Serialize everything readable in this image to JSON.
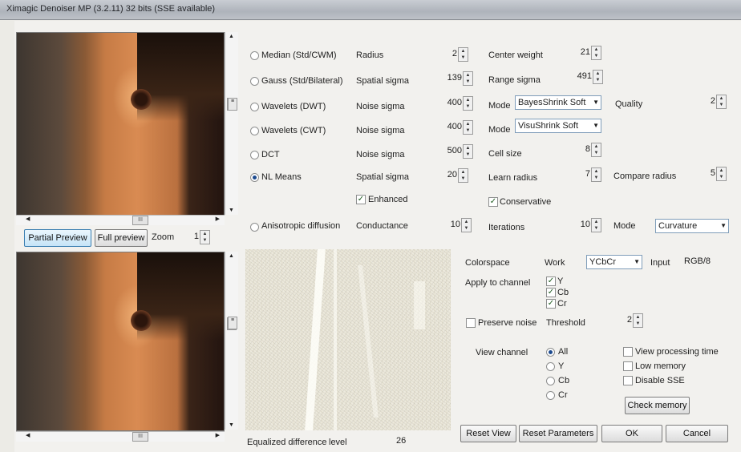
{
  "window": {
    "title": "Ximagic Denoiser MP (3.2.11) 32 bits (SSE available)"
  },
  "preview": {
    "partial_label": "Partial Preview",
    "full_label": "Full preview",
    "zoom_label": "Zoom",
    "zoom_value": "1"
  },
  "methods": [
    {
      "label": "Median (Std/CWM)",
      "selected": false,
      "p1_label": "Radius",
      "p1_value": "2",
      "p2_label": "Center weight",
      "p2_value": "21"
    },
    {
      "label": "Gauss (Std/Bilateral)",
      "selected": false,
      "p1_label": "Spatial sigma",
      "p1_value": "139",
      "p2_label": "Range sigma",
      "p2_value": "491"
    },
    {
      "label": "Wavelets (DWT)",
      "selected": false,
      "p1_label": "Noise sigma",
      "p1_value": "400",
      "p2_label": "Mode",
      "p2_value": "BayesShrink Soft",
      "p3_label": "Quality",
      "p3_value": "2"
    },
    {
      "label": "Wavelets (CWT)",
      "selected": false,
      "p1_label": "Noise sigma",
      "p1_value": "400",
      "p2_label": "Mode",
      "p2_value": "VisuShrink Soft"
    },
    {
      "label": "DCT",
      "selected": false,
      "p1_label": "Noise sigma",
      "p1_value": "500",
      "p2_label": "Cell size",
      "p2_value": "8"
    },
    {
      "label": "NL Means",
      "selected": true,
      "p1_label": "Spatial sigma",
      "p1_value": "20",
      "p2_label": "Learn radius",
      "p2_value": "7",
      "p3_label": "Compare radius",
      "p3_value": "5"
    },
    {
      "label": "Anisotropic diffusion",
      "selected": false,
      "p1_label": "Conductance",
      "p1_value": "10",
      "p2_label": "Iterations",
      "p2_value": "10",
      "p3_label": "Mode",
      "p3_value": "Curvature"
    }
  ],
  "options": {
    "enhanced": "Enhanced",
    "conservative": "Conservative"
  },
  "colorspace": {
    "label": "Colorspace",
    "work_label": "Work",
    "work_value": "YCbCr",
    "input_label": "Input",
    "input_value": "RGB/8"
  },
  "apply": {
    "label": "Apply to channel",
    "channels": [
      "Y",
      "Cb",
      "Cr"
    ]
  },
  "noise": {
    "preserve_label": "Preserve noise",
    "threshold_label": "Threshold",
    "threshold_value": "2"
  },
  "view": {
    "label": "View channel",
    "channels": [
      "All",
      "Y",
      "Cb",
      "Cr"
    ],
    "selected": "All"
  },
  "flags": {
    "processing_time": "View processing time",
    "low_memory": "Low memory",
    "disable_sse": "Disable SSE",
    "check_memory": "Check memory"
  },
  "difference": {
    "label": "Equalized difference",
    "level_label": "level",
    "level_value": "26"
  },
  "buttons": {
    "reset_view": "Reset View",
    "reset_params": "Reset Parameters",
    "ok": "OK",
    "cancel": "Cancel"
  },
  "scroll_thumb": "III"
}
